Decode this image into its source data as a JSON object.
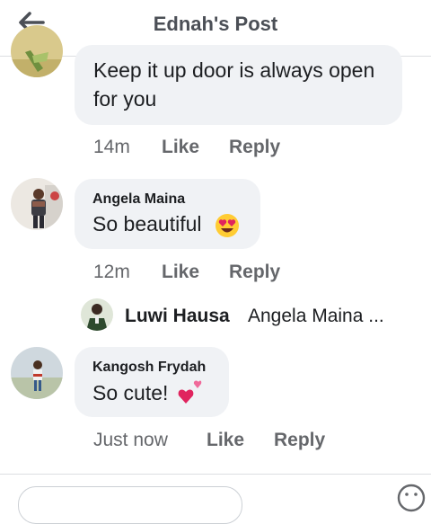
{
  "header": {
    "title": "Ednah's Post"
  },
  "comments": [
    {
      "name": "",
      "text_line1": "Keep it up door is always open",
      "text_line2": "for you",
      "time": "14m",
      "like": "Like",
      "reply": "Reply"
    },
    {
      "name": "Angela Maina",
      "text": "So beautiful",
      "emoji": "heart-eyes-emoji",
      "time": "12m",
      "like": "Like",
      "reply": "Reply"
    },
    {
      "name": "Kangosh Frydah",
      "text": "So cute!",
      "emoji": "two-hearts-emoji",
      "time": "Just now",
      "like": "Like",
      "reply": "Reply"
    }
  ],
  "reply_preview": {
    "name": "Luwi Hausa",
    "text": "Angela Maina ..."
  },
  "colors": {
    "bubble": "#f0f2f5",
    "meta_text": "#65676b",
    "title_text": "#4b4f56"
  }
}
